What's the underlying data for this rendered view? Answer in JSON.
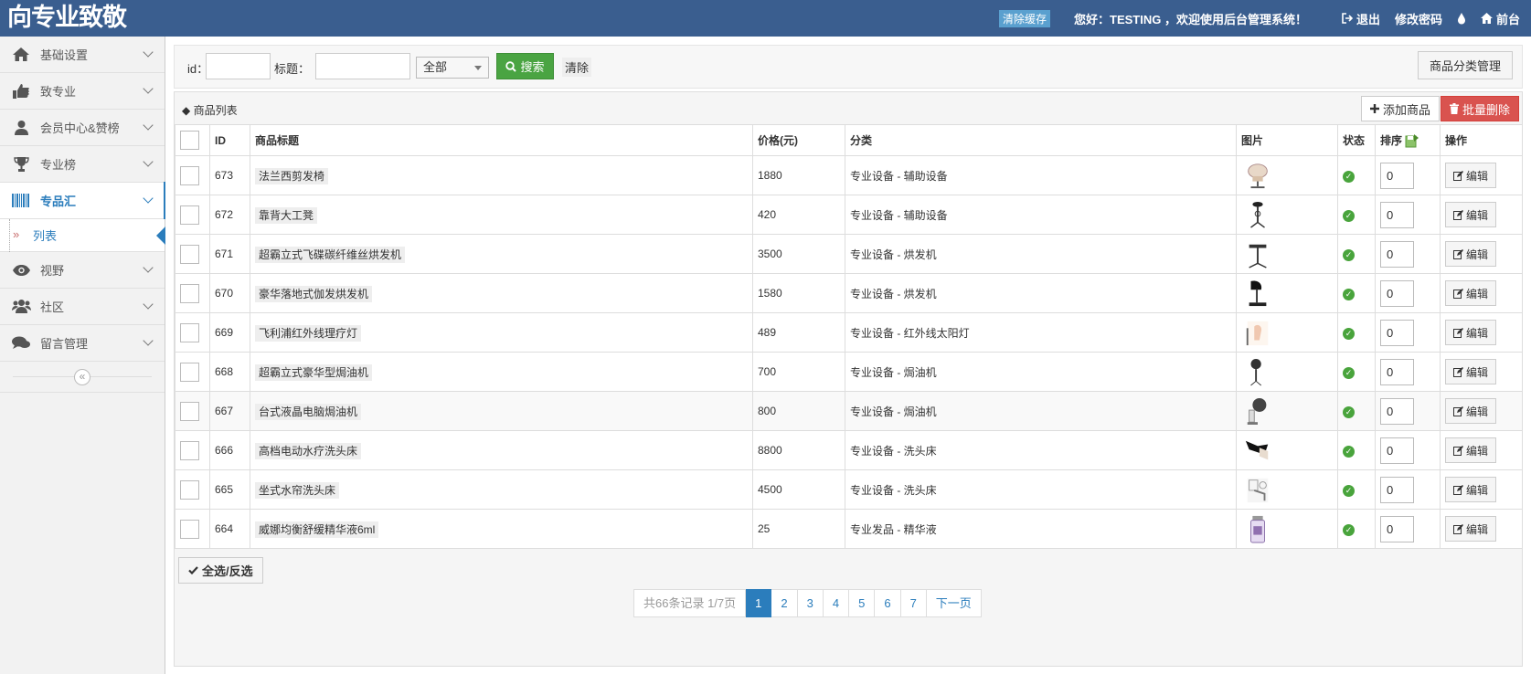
{
  "header": {
    "logo": "向专业致敬",
    "clear_cache": "清除缓存",
    "greeting": "您好：TESTING ，欢迎使用后台管理系统！",
    "logout": "退出",
    "change_password": "修改密码",
    "frontend": "前台"
  },
  "sidebar": {
    "items": [
      {
        "label": "基础设置",
        "icon": "home-icon"
      },
      {
        "label": "致专业",
        "icon": "thumbs-up-icon"
      },
      {
        "label": "会员中心&赞榜",
        "icon": "user-icon"
      },
      {
        "label": "专业榜",
        "icon": "trophy-icon"
      },
      {
        "label": "专品汇",
        "icon": "barcode-icon"
      },
      {
        "label": "视野",
        "icon": "eye-icon"
      },
      {
        "label": "社区",
        "icon": "users-icon"
      },
      {
        "label": "留言管理",
        "icon": "comments-icon"
      }
    ],
    "sub_item": "列表",
    "collapse": "«"
  },
  "search": {
    "id_label": "id：",
    "title_label": "标题：",
    "select_value": "全部",
    "search_button": "搜索",
    "clear_button": "清除",
    "category_button": "商品分类管理"
  },
  "panel": {
    "title": "商品列表",
    "add_button": "添加商品",
    "batch_delete_button": "批量删除",
    "select_all_button": "全选/反选"
  },
  "table": {
    "headers": [
      "ID",
      "商品标题",
      "价格(元)",
      "分类",
      "图片",
      "状态",
      "排序",
      "操作"
    ],
    "edit_label": "编辑",
    "rows": [
      {
        "id": "673",
        "title": "法兰西剪发椅",
        "price": "1880",
        "category": "专业设备 - 辅助设备",
        "sort": "0"
      },
      {
        "id": "672",
        "title": "靠背大工凳",
        "price": "420",
        "category": "专业设备 - 辅助设备",
        "sort": "0"
      },
      {
        "id": "671",
        "title": "超霸立式飞碟碳纤维丝烘发机",
        "price": "3500",
        "category": "专业设备 - 烘发机",
        "sort": "0"
      },
      {
        "id": "670",
        "title": "豪华落地式伽发烘发机",
        "price": "1580",
        "category": "专业设备 - 烘发机",
        "sort": "0"
      },
      {
        "id": "669",
        "title": "飞利浦红外线理疗灯",
        "price": "489",
        "category": "专业设备 - 红外线太阳灯",
        "sort": "0"
      },
      {
        "id": "668",
        "title": "超霸立式豪华型焗油机",
        "price": "700",
        "category": "专业设备 - 焗油机",
        "sort": "0"
      },
      {
        "id": "667",
        "title": "台式液晶电脑焗油机",
        "price": "800",
        "category": "专业设备 - 焗油机",
        "sort": "0"
      },
      {
        "id": "666",
        "title": "高档电动水疗洗头床",
        "price": "8800",
        "category": "专业设备 - 洗头床",
        "sort": "0"
      },
      {
        "id": "665",
        "title": "坐式水帘洗头床",
        "price": "4500",
        "category": "专业设备 - 洗头床",
        "sort": "0"
      },
      {
        "id": "664",
        "title": "威娜均衡舒缓精华液6ml",
        "price": "25",
        "category": "专业发品 - 精华液",
        "sort": "0"
      }
    ]
  },
  "pagination": {
    "summary": "共66条记录 1/7页",
    "pages": [
      "1",
      "2",
      "3",
      "4",
      "5",
      "6",
      "7"
    ],
    "current": "1",
    "next": "下一页"
  }
}
